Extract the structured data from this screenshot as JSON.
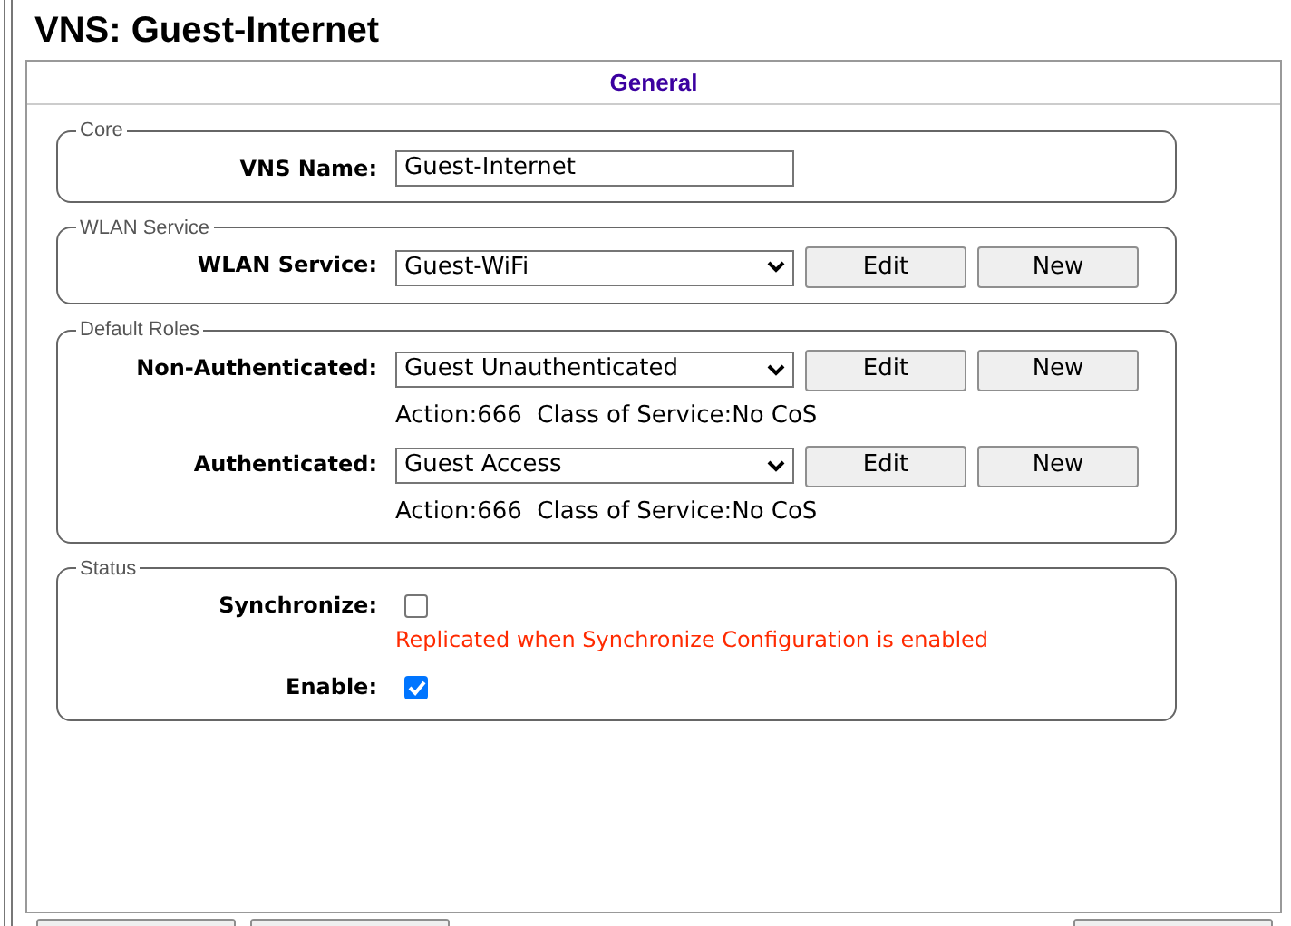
{
  "title": "VNS: Guest-Internet",
  "tab": {
    "label": "General"
  },
  "sections": [
    {
      "legend": "Core",
      "rows": [
        {
          "kind": "text",
          "label": "VNS Name:",
          "value": "Guest-Internet"
        }
      ]
    },
    {
      "legend": "WLAN Service",
      "rows": [
        {
          "kind": "select",
          "label": "WLAN Service:",
          "value": "Guest-WiFi",
          "buttons": [
            "Edit",
            "New"
          ]
        }
      ]
    },
    {
      "legend": "Default Roles",
      "rows": [
        {
          "kind": "select",
          "label": "Non-Authenticated:",
          "value": "Guest Unauthenticated",
          "buttons": [
            "Edit",
            "New"
          ],
          "info": "Action:666  Class of Service:No CoS"
        },
        {
          "kind": "select",
          "label": "Authenticated:",
          "value": "Guest Access",
          "buttons": [
            "Edit",
            "New"
          ],
          "info": "Action:666  Class of Service:No CoS"
        }
      ]
    },
    {
      "legend": "Status",
      "rows": [
        {
          "kind": "checkbox",
          "label": "Synchronize:",
          "checked": false,
          "note": "Replicated when Synchronize Configuration is enabled"
        },
        {
          "kind": "checkbox",
          "label": "Enable:",
          "checked": true
        }
      ]
    }
  ]
}
